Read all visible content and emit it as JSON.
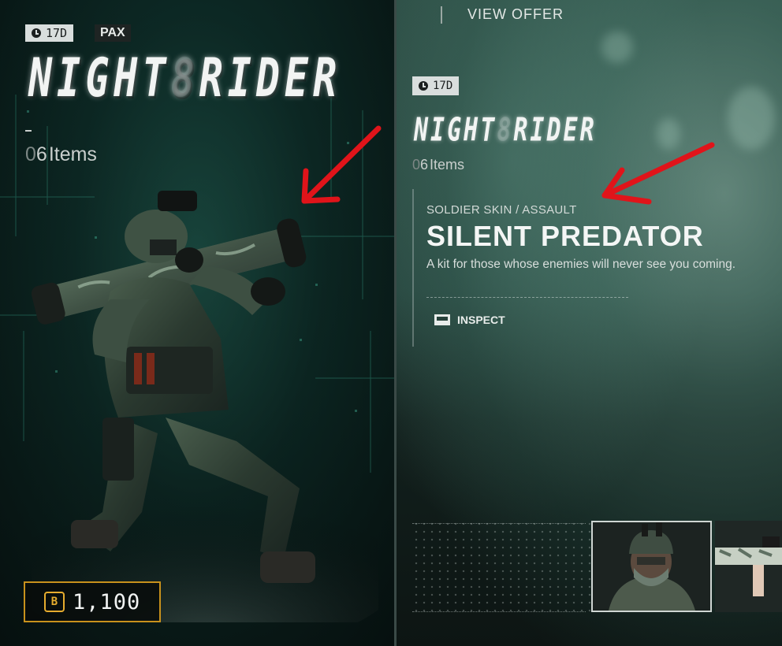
{
  "left": {
    "timer": "17D",
    "brand": "PAX",
    "title_word1": "NIGHT",
    "title_word2": "RIDER",
    "items_prefix": "0",
    "items_count": "6",
    "items_label": "Items",
    "price": "1,100",
    "currency_icon": "bp-coin-icon"
  },
  "right": {
    "view_offer": "VIEW OFFER",
    "timer": "17D",
    "title_word1": "NIGHT",
    "title_word2": "RIDER",
    "items_prefix": "0",
    "items_count": "6",
    "items_label": "Items",
    "category": "SOLDIER SKIN / ASSAULT",
    "item_name": "SILENT PREDATOR",
    "description": "A kit for those whose enemies will never see you coming.",
    "inspect_label": "INSPECT"
  },
  "colors": {
    "price_border": "#c8911c",
    "annotation": "#e0141a",
    "accent_teal": "#2e6b5e"
  }
}
